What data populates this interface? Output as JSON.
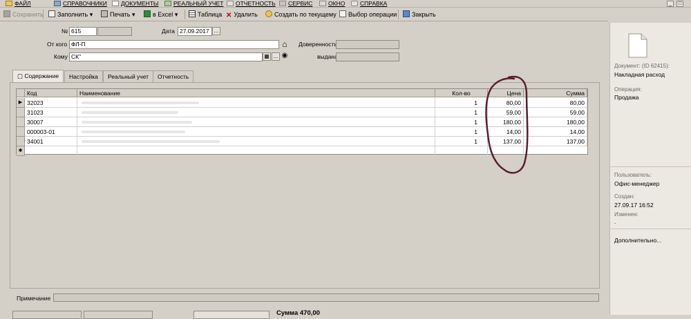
{
  "menu": [
    {
      "label": "ФАЙЛ",
      "icon": "folder-icon"
    },
    {
      "label": "СПРАВОЧНИКИ",
      "icon": "book-icon"
    },
    {
      "label": "ДОКУМЕНТЫ",
      "icon": "documents-icon"
    },
    {
      "label": "РЕАЛЬНЫЙ УЧЕТ",
      "icon": "ledger-icon"
    },
    {
      "label": "ОТЧЕТНОСТЬ",
      "icon": "report-icon"
    },
    {
      "label": "СЕРВИС",
      "icon": "service-icon"
    },
    {
      "label": "ОКНО",
      "icon": "window-icon"
    },
    {
      "label": "СПРАВКА",
      "icon": "help-icon"
    }
  ],
  "window_controls": {
    "minimize": "_",
    "restore": "□"
  },
  "toolbar": {
    "save": "Сохранить",
    "fill": "Заполнить",
    "print": "Печать",
    "excel": "в Excel",
    "table": "Таблица",
    "delete": "Удалить",
    "create_based": "Создать по текущему",
    "choose_operation": "Выбор операции",
    "close": "Закрыть"
  },
  "form": {
    "number_label": "№",
    "number_value": "615",
    "date_label": "Дата",
    "date_value": "27.09.2017",
    "from_label": "От кого",
    "from_value": "ФЛ-П",
    "to_label": "Кому",
    "to_value": "СК\"",
    "power_of_attorney_label": "Доверенность",
    "issued_label": "выдана",
    "ellipsis": "..."
  },
  "tabs": [
    "Содержание",
    "Настройка",
    "Реальный учет",
    "Отчетность"
  ],
  "grid": {
    "columns": [
      "Код",
      "Наименование",
      "Кол-во",
      "Цена",
      "Сумма"
    ],
    "rows": [
      {
        "code": "32023",
        "qty": "1",
        "price": "80,00",
        "sum": "80,00"
      },
      {
        "code": "31023",
        "qty": "1",
        "price": "59,00",
        "sum": "59,00"
      },
      {
        "code": "30007",
        "qty": "1",
        "price": "180,00",
        "sum": "180,00"
      },
      {
        "code": "000003-01",
        "qty": "1",
        "price": "14,00",
        "sum": "14,00"
      },
      {
        "code": "34001",
        "qty": "1",
        "price": "137,00",
        "sum": "137,00"
      }
    ],
    "current_marker": "▶",
    "new_row_marker": "✱"
  },
  "note_label": "Примечание",
  "total": {
    "label": "Сумма",
    "value": "470,00"
  },
  "side": {
    "document_label": "Документ: (ID 62415):",
    "document_value": "Накладная расход",
    "operation_label": "Операция:",
    "operation_value": "Продажа",
    "user_label": "Пользователь:",
    "user_value": "Офис-менеджер",
    "created_label": "Создан:",
    "created_value": "27.09.17  16:52",
    "changed_label": "Изменен:",
    "changed_value": ".",
    "more": "Дополнительно..."
  },
  "colors": {
    "annotation": "#5a1e2e",
    "panel": "#d4d0c8",
    "side": "#ece9e2"
  }
}
